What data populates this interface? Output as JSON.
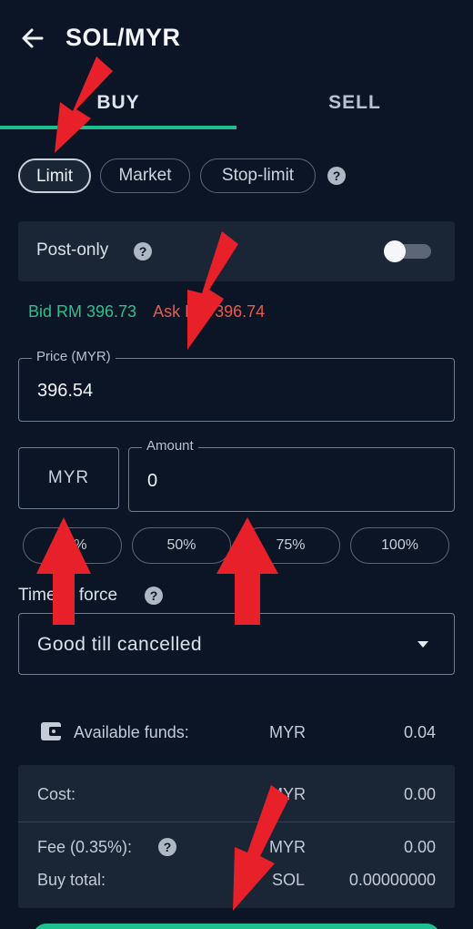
{
  "header": {
    "title": "SOL/MYR"
  },
  "tabs": [
    {
      "label": "BUY"
    },
    {
      "label": "SELL"
    }
  ],
  "order_types": [
    {
      "label": "Limit"
    },
    {
      "label": "Market"
    },
    {
      "label": "Stop-limit"
    }
  ],
  "help_glyph": "?",
  "post_only": {
    "label": "Post-only",
    "enabled": false
  },
  "quotes": {
    "bid": "Bid RM 396.73",
    "ask": "Ask RM 396.74"
  },
  "price_field": {
    "label": "Price (MYR)",
    "value": "396.54"
  },
  "amount": {
    "currency": "MYR",
    "label": "Amount",
    "value": "0"
  },
  "percent_buttons": [
    {
      "label": "25%"
    },
    {
      "label": "50%"
    },
    {
      "label": "75%"
    },
    {
      "label": "100%"
    }
  ],
  "time_in_force": {
    "label": "Time in force",
    "selected": "Good till cancelled"
  },
  "available_funds": {
    "label": "Available funds:",
    "currency": "MYR",
    "value": "0.04"
  },
  "summary": {
    "cost": {
      "label": "Cost:",
      "currency": "MYR",
      "value": "0.00"
    },
    "fee": {
      "label": "Fee (0.35%):",
      "currency": "MYR",
      "value": "0.00"
    },
    "total": {
      "label": "Buy total:",
      "currency": "SOL",
      "value": "0.00000000"
    }
  },
  "colors": {
    "background": "#0b1526",
    "accent": "#1dbf8e",
    "bid": "#2fbf8c",
    "ask": "#e65a4f",
    "annotation_arrow": "#e8202a"
  }
}
